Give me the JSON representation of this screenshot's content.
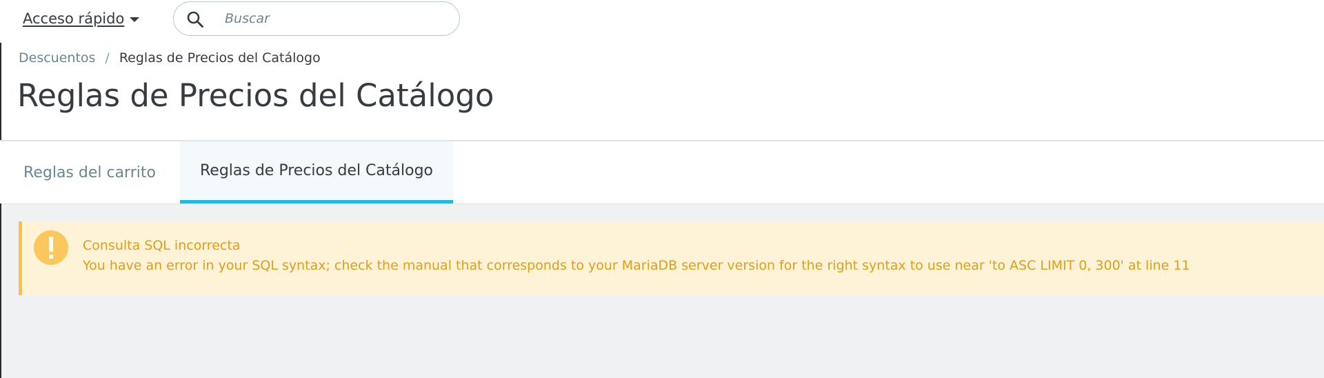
{
  "topbar": {
    "quick_access_label": "Acceso rápido",
    "search_placeholder": "Buscar"
  },
  "header": {
    "breadcrumb": {
      "parent": "Descuentos",
      "separator": "/",
      "current": "Reglas de Precios del Catálogo"
    },
    "title": "Reglas de Precios del Catálogo"
  },
  "tabs": [
    {
      "label": "Reglas del carrito",
      "active": false
    },
    {
      "label": "Reglas de Precios del Catálogo",
      "active": true
    }
  ],
  "alert": {
    "type": "warning",
    "icon": "exclamation-circle-icon",
    "title": "Consulta SQL incorrecta",
    "message": "You have an error in your SQL syntax; check the manual that corresponds to your MariaDB server version for the right syntax to use near 'to ASC LIMIT 0, 300' at line 11"
  },
  "colors": {
    "accent": "#25b9d7",
    "warning_bg": "#fff3d7",
    "warning_border": "#fcbf47",
    "warning_text": "#dd9e1a",
    "breadcrumb_separator": "#70b580"
  }
}
